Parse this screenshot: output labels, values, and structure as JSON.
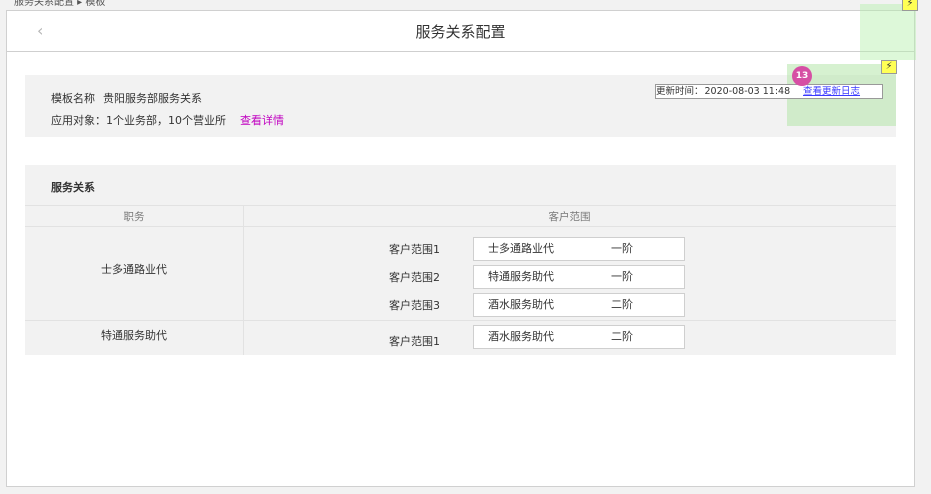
{
  "window": {
    "title": "服务关系配置"
  },
  "template": {
    "name_label": "模板名称",
    "name_value": "贵阳服务部服务关系",
    "target_label": "应用对象：",
    "target_value": "1个业务部，10个营业所",
    "details_link": "查看详情",
    "update_label": "更新时间：",
    "update_time": "2020-08-03 11:48",
    "log_link": "查看更新日志",
    "badge_count": "13"
  },
  "relations": {
    "section_title": "服务关系",
    "columns": [
      "职务",
      "客户范围"
    ],
    "groups": [
      {
        "role": "士多通路业代",
        "ranges": [
          {
            "label": "客户范围1",
            "name": "士多通路业代",
            "level": "一阶"
          },
          {
            "label": "客户范围2",
            "name": "特通服务助代",
            "level": "一阶"
          },
          {
            "label": "客户范围3",
            "name": "酒水服务助代",
            "level": "二阶"
          }
        ]
      },
      {
        "role": "特通服务助代",
        "ranges": [
          {
            "label": "客户范围1",
            "name": "酒水服务助代",
            "level": "二阶"
          }
        ]
      }
    ]
  },
  "icons": {
    "back": "chevron-left-icon",
    "bolt": "lightning-icon"
  },
  "colors": {
    "link": "#c000c0",
    "log_link": "#3a3aff",
    "badge": "#d64fa4",
    "highlight": "#b4f0aa",
    "bolt_bg": "#ffff55"
  }
}
